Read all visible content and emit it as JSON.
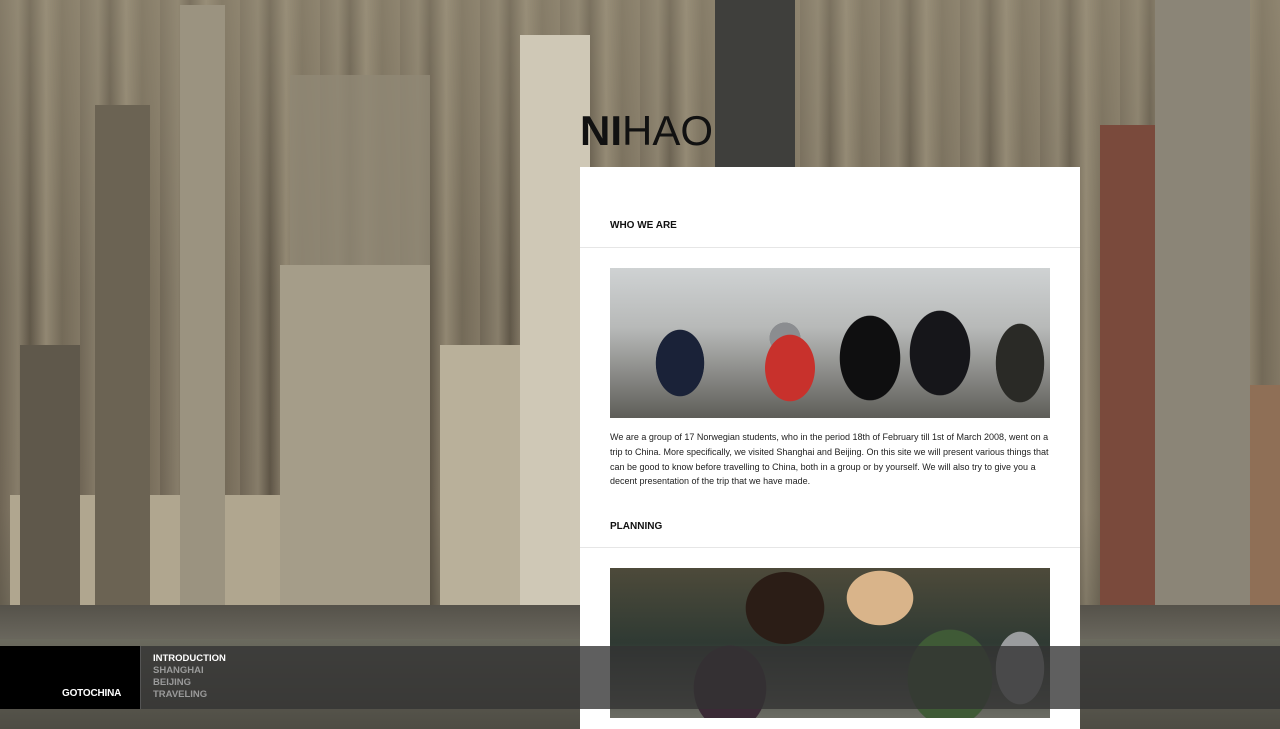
{
  "site": {
    "title_bold": "NI",
    "title_rest": "HAO"
  },
  "sections": [
    {
      "heading": "WHO WE ARE",
      "text": "We are a group of 17 Norwegian students, who in the period 18th of February till 1st of March 2008, went on a trip to China. More specifically, we visited Shanghai and Beijing. On this site we will present various things that can be good to know before travelling to China, both in a group or by yourself. We will also try to give you a decent presentation of the trip that we have made."
    },
    {
      "heading": "PLANNING"
    }
  ],
  "nav": {
    "brand": "GOTOCHINA",
    "items": [
      {
        "label": "INTRODUCTION",
        "active": true
      },
      {
        "label": "SHANGHAI",
        "active": false
      },
      {
        "label": "BEIJING",
        "active": false
      },
      {
        "label": "TRAVELING",
        "active": false
      }
    ]
  }
}
